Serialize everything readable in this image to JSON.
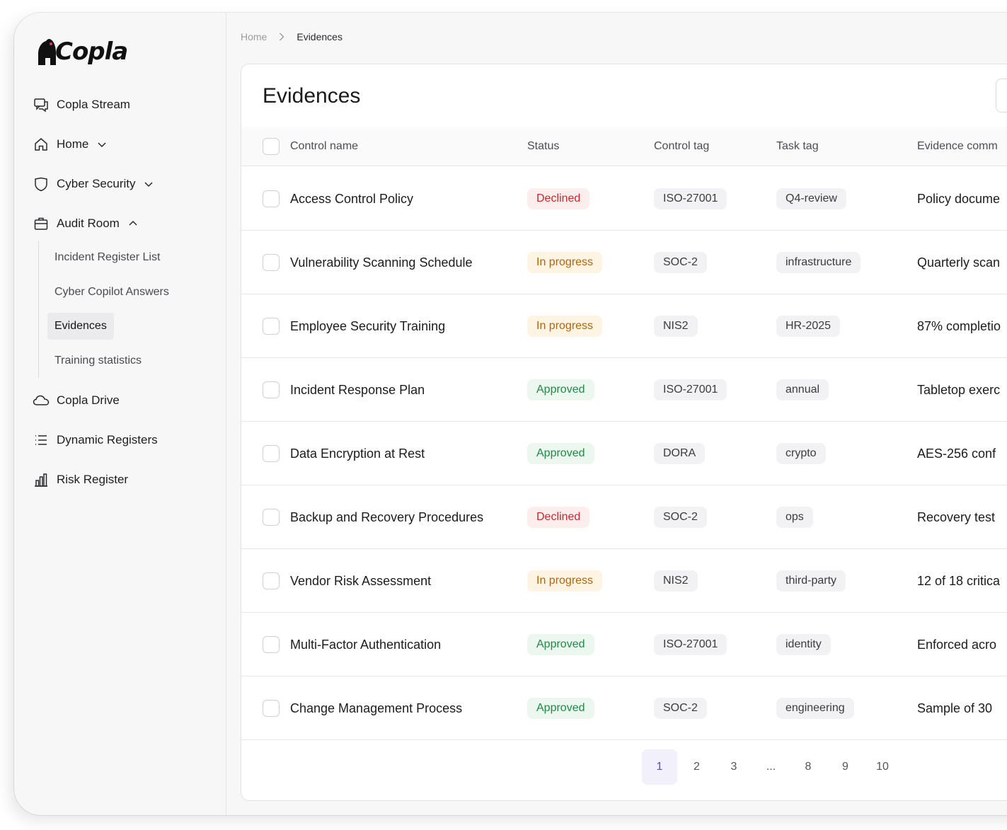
{
  "app": {
    "logo_text": "Copla"
  },
  "sidebar": {
    "items": [
      {
        "label": "Copla Stream",
        "icon": "chat-icon"
      },
      {
        "label": "Home",
        "icon": "home-icon",
        "chevron": "down"
      },
      {
        "label": "Cyber Security",
        "icon": "shield-icon",
        "chevron": "down"
      },
      {
        "label": "Audit Room",
        "icon": "briefcase-icon",
        "chevron": "up"
      },
      {
        "label": "Copla Drive",
        "icon": "cloud-icon"
      },
      {
        "label": "Dynamic Registers",
        "icon": "list-icon"
      },
      {
        "label": "Risk Register",
        "icon": "bar-chart-icon"
      }
    ],
    "audit_room_sub": [
      {
        "label": "Incident Register List"
      },
      {
        "label": "Cyber Copilot Answers"
      },
      {
        "label": "Evidences",
        "active": true
      },
      {
        "label": "Training statistics"
      }
    ]
  },
  "breadcrumb": {
    "home": "Home",
    "current": "Evidences"
  },
  "page": {
    "title": "Evidences"
  },
  "table": {
    "headers": [
      "Control name",
      "Status",
      "Control tag",
      "Task tag",
      "Evidence comm"
    ],
    "rows": [
      {
        "name": "Access Control Policy",
        "status": "Declined",
        "status_type": "declined",
        "control_tag": "ISO-27001",
        "task_tag": "Q4-review",
        "comment": "Policy docume"
      },
      {
        "name": "Vulnerability Scanning Schedule",
        "status": "In progress",
        "status_type": "progress",
        "control_tag": "SOC-2",
        "task_tag": "infrastructure",
        "comment": "Quarterly scan"
      },
      {
        "name": "Employee Security Training",
        "status": "In progress",
        "status_type": "progress",
        "control_tag": "NIS2",
        "task_tag": "HR-2025",
        "comment": "87% completio"
      },
      {
        "name": "Incident Response Plan",
        "status": "Approved",
        "status_type": "approved",
        "control_tag": "ISO-27001",
        "task_tag": "annual",
        "comment": "Tabletop exerc"
      },
      {
        "name": "Data Encryption at Rest",
        "status": "Approved",
        "status_type": "approved",
        "control_tag": "DORA",
        "task_tag": "crypto",
        "comment": "AES-256 conf"
      },
      {
        "name": "Backup and Recovery Procedures",
        "status": "Declined",
        "status_type": "declined",
        "control_tag": "SOC-2",
        "task_tag": "ops",
        "comment": "Recovery test"
      },
      {
        "name": "Vendor Risk Assessment",
        "status": "In progress",
        "status_type": "progress",
        "control_tag": "NIS2",
        "task_tag": "third-party",
        "comment": "12 of 18 critica"
      },
      {
        "name": "Multi-Factor Authentication",
        "status": "Approved",
        "status_type": "approved",
        "control_tag": "ISO-27001",
        "task_tag": "identity",
        "comment": "Enforced acro"
      },
      {
        "name": "Change Management Process",
        "status": "Approved",
        "status_type": "approved",
        "control_tag": "SOC-2",
        "task_tag": "engineering",
        "comment": "Sample of 30"
      }
    ]
  },
  "pagination": {
    "pages": [
      "1",
      "2",
      "3",
      "...",
      "8",
      "9",
      "10"
    ],
    "current": "1"
  },
  "colors": {
    "accent": "#5b4bc4",
    "declined": "#c42a2a",
    "in_progress": "#b3650a",
    "approved": "#1f8a44"
  }
}
